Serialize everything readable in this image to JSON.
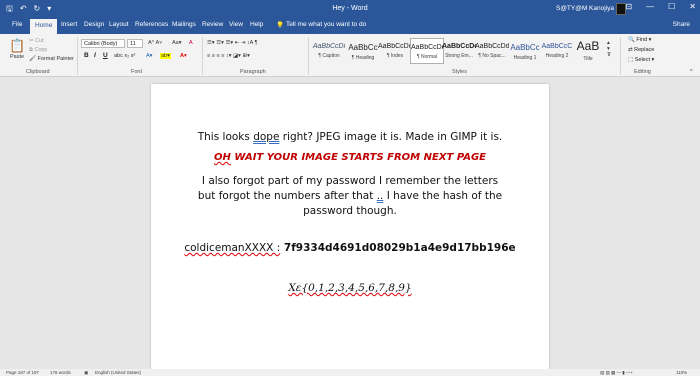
{
  "window": {
    "title": "Hey - Word",
    "user": "S@TY@M Kanojiya",
    "qat": {
      "save": "🖫",
      "undo": "↶",
      "redo": "↻",
      "customize": "▾"
    },
    "controls": {
      "restore_ribbon": "⊡",
      "minimize": "—",
      "maximize": "☐",
      "close": "✕"
    }
  },
  "tabs": [
    "File",
    "Home",
    "Insert",
    "Design",
    "Layout",
    "References",
    "Mailings",
    "Review",
    "View",
    "Help"
  ],
  "tell_me": "Tell me what you want to do",
  "share": "Share",
  "ribbon": {
    "clipboard": {
      "paste": "Paste",
      "cut": "Cut",
      "copy": "Copy",
      "format_painter": "Format Painter",
      "label": "Clipboard"
    },
    "font": {
      "name": "Calibri (Body)",
      "size": "11",
      "bold": "B",
      "italic": "I",
      "underline": "U",
      "label": "Font"
    },
    "paragraph": {
      "label": "Paragraph"
    },
    "styles": {
      "label": "Styles",
      "items": [
        {
          "sample": "AaBbCcDi",
          "name": "¶ Caption"
        },
        {
          "sample": "AaBbCc",
          "name": "¶ Heading"
        },
        {
          "sample": "AaBbCcDd",
          "name": "¶ Index"
        },
        {
          "sample": "AaBbCcDd",
          "name": "¶ Normal"
        },
        {
          "sample": "AaBbCcDc",
          "name": "Strong Em..."
        },
        {
          "sample": "AaBbCcDd",
          "name": "¶ No Spac..."
        },
        {
          "sample": "AaBbCc",
          "name": "Heading 1"
        },
        {
          "sample": "AaBbCcC",
          "name": "Heading 2"
        },
        {
          "sample": "AaB",
          "name": "Title"
        }
      ]
    },
    "editing": {
      "find": "Find",
      "replace": "Replace",
      "select": "Select",
      "label": "Editing"
    }
  },
  "document": {
    "line1_pre": "This looks ",
    "line1_err": "dope",
    "line1_post": " right? JPEG image it is. Made in GIMP it is.",
    "line2_err": "OH",
    "line2_post": " WAIT YOUR IMAGE STARTS FROM NEXT PAGE",
    "line3_pre": "I also forgot part of my password I remember the letters but forgot the numbers after that ",
    "line3_err": "..",
    "line3_post": " I have the hash of the password though.",
    "hash_err": "coldicemanXXXX :",
    "hash_value": " 7f9334d4691d08029b1a4e9d17bb196e",
    "charset": "Xε{0,1,2,3,4,5,6,7,8,9}"
  },
  "status": {
    "page": "Page 187 of 197",
    "words": "176 words",
    "language": "English (United States)",
    "zoom": "110%"
  },
  "colors": {
    "accent": "#2b579a",
    "warning_text": "#c00000"
  }
}
